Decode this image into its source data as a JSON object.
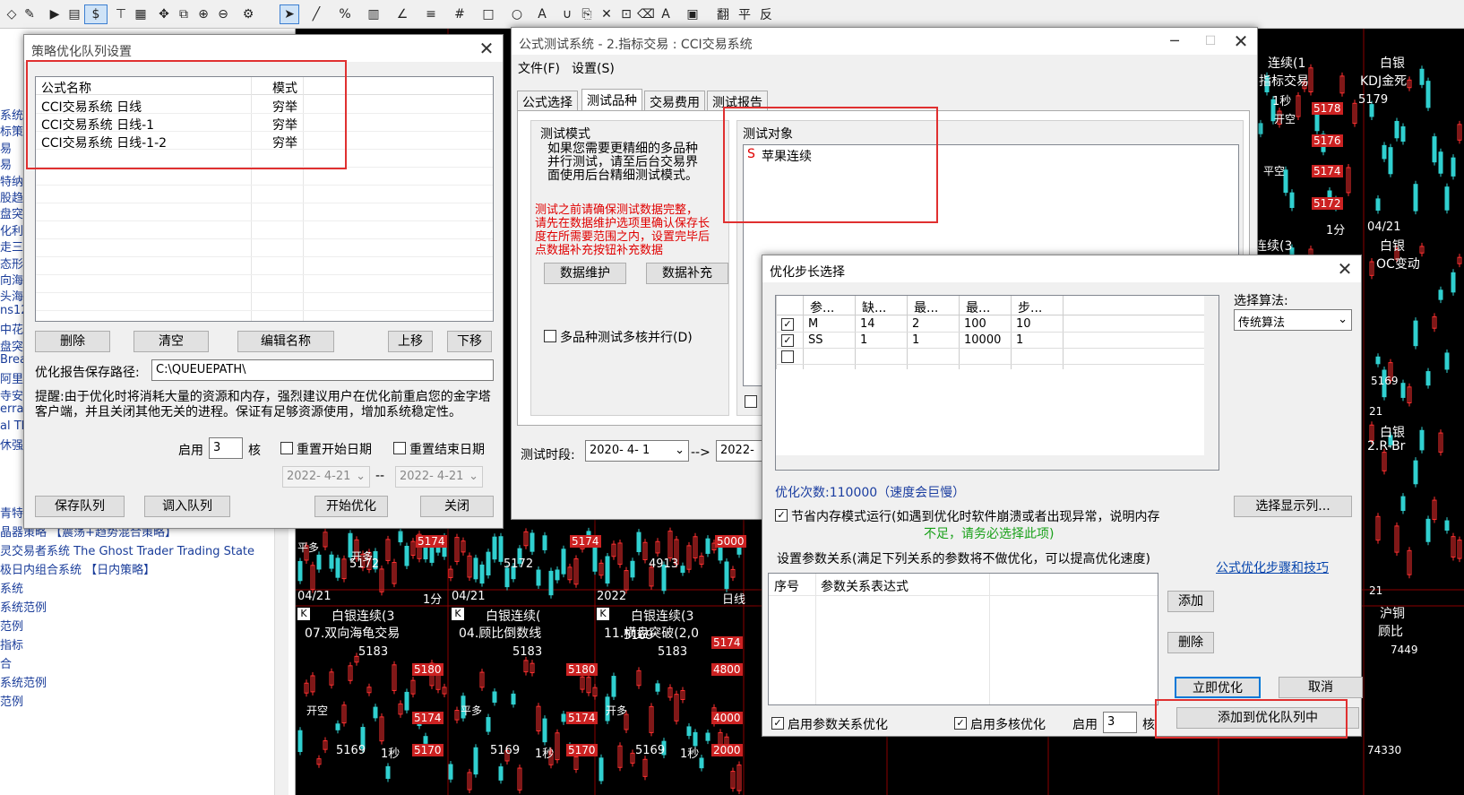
{
  "toolbar": {
    "currency_symbol": "$",
    "text_tool": "A",
    "right_tools": [
      "翻",
      "平",
      "反"
    ]
  },
  "left_panel": {
    "items": [
      "系统",
      "标策",
      "易",
      "易",
      "特纳",
      "股趋",
      "盘突",
      "化利",
      "走三",
      "态形",
      "向海",
      "头海",
      "ns12",
      "中花",
      "盘突",
      "Brea",
      "阿里",
      "寺安",
      "erra",
      "al Tl",
      "休强",
      "青特纳交易系统 【中长期策略】",
      "晶器策略 【震荡+趋势混合策略】",
      "灵交易者系统 The Ghost Trader Trading State",
      "极日内组合系统 【日内策略】",
      "系统",
      "系统范例",
      "范例",
      "指标",
      "合",
      "系统范例",
      "范例"
    ]
  },
  "charts": {
    "top_right": [
      {
        "title": "连续(1",
        "sub": "指标交易",
        "p1": "5178",
        "p2": "5176",
        "p3": "5174",
        "p4": "5172",
        "t1": "1秒",
        "t2": "开空",
        "t3": "平空",
        "t4": "1分",
        "t5": "04/21"
      },
      {
        "title": "白银",
        "sub": "KDJ金死",
        "p1": "5179"
      }
    ],
    "row1": [
      {
        "date": "04/21",
        "time": "1分",
        "title": "白银连续(3",
        "sub": "07.双向海龟交易",
        "price": "5183",
        "p_a": "5180",
        "p_b": "5174",
        "p_c": "5170",
        "bottom": "5169",
        "tb": "1秒",
        "m": "开空",
        "p_top": "5174",
        "p_mid": "5172",
        "m2": "平多",
        "m3": "开多"
      },
      {
        "date": "04/21",
        "time": "",
        "title": "白银连续(",
        "sub": "04.顾比倒数线",
        "price": "5183",
        "p_a": "5180",
        "p_b": "5174",
        "p_c": "5170",
        "bottom": "5169",
        "tb": "1秒",
        "m": "平多",
        "p_top": "5174",
        "p_mid": "5172"
      },
      {
        "date": "2022",
        "time": "日线",
        "title": "白银连续(3",
        "sub": "11.横盘突破(2,0",
        "price": "5183",
        "p_a": "4800",
        "p_b": "4000",
        "p_c": "2000",
        "bottom": "5169",
        "tb": "1秒",
        "m": "开多",
        "p_top": "5000",
        "p_mid": "4913",
        "p_x": "5174",
        "p_y": "5169"
      }
    ],
    "right_col": {
      "a": "连续(3",
      "b": "白银",
      "c": "OC变动",
      "d": "5169",
      "e": "21",
      "f": "白银",
      "g": "2.R-Br",
      "h": "21",
      "i": "沪铜",
      "j": "顾比",
      "k": "7449",
      "l": "74330",
      "m": "5174",
      "n": "04/21",
      "o": "1分",
      "p": "21",
      "q": "K"
    }
  },
  "win1": {
    "title": "策略优化队列设置",
    "col_name": "公式名称",
    "col_mode": "模式",
    "rows": [
      {
        "name": "CCI交易系统 日线",
        "mode": "穷举"
      },
      {
        "name": "CCI交易系统 日线-1",
        "mode": "穷举"
      },
      {
        "name": "CCI交易系统 日线-1-2",
        "mode": "穷举"
      }
    ],
    "btn_delete": "删除",
    "btn_clear": "清空",
    "btn_rename": "编辑名称",
    "btn_up": "上移",
    "btn_down": "下移",
    "path_label": "优化报告保存路径:",
    "path_value": "C:\\QUEUEPATH\\",
    "tip": "提醒:由于优化时将消耗大量的资源和内存，强烈建议用户在优化前重启您的金字塔客户端，并且关闭其他无关的进程。保证有足够资源使用，增加系统稳定性。",
    "cores_label": "启用",
    "cores_value": "3",
    "cores_unit": "核",
    "reset_start": "重置开始日期",
    "reset_end": "重置结束日期",
    "date_start": "2022- 4-21",
    "date_sep": "--",
    "date_end": "2022- 4-21",
    "btn_save": "保存队列",
    "btn_load": "调入队列",
    "btn_start": "开始优化",
    "btn_close": "关闭"
  },
  "win2": {
    "title": "公式测试系统 - 2.指标交易 : CCI交易系统",
    "menu": [
      "文件(F)",
      "设置(S)"
    ],
    "tabs": [
      "公式选择",
      "测试品种",
      "交易费用",
      "测试报告"
    ],
    "mode_title": "测试模式",
    "mode_desc": [
      "如果您需要更精细的多品种",
      "并行测试，请至后台交易界",
      "面使用后台精细测试模式。"
    ],
    "warn": [
      "测试之前请确保测试数据完整，",
      "请先在数据维护选项里确认保存长",
      "度在所需要范围之内，设置完毕后",
      "点数据补充按钮补充数据"
    ],
    "btn_maint": "数据维护",
    "btn_supp": "数据补充",
    "multi": "多品种测试多核并行(D)",
    "target_title": "测试对象",
    "target_tag": "S",
    "target_item": "苹果连续",
    "period_label": "测试时段:",
    "period_from": "2020- 4- 1",
    "period_arrow": "-->",
    "period_to": "2022-"
  },
  "win3": {
    "title": "优化步长选择",
    "cols": [
      "参...",
      "缺...",
      "最...",
      "最...",
      "步..."
    ],
    "rows": [
      {
        "checked": "✓",
        "param": "M",
        "def": "14",
        "min": "2",
        "max": "100",
        "step": "10"
      },
      {
        "checked": "✓",
        "param": "SS",
        "def": "1",
        "min": "1",
        "max": "10000",
        "step": "1"
      },
      {
        "checked": "",
        "param": "",
        "def": "",
        "min": "",
        "max": "",
        "step": ""
      }
    ],
    "algo_label": "选择算法:",
    "algo_value": "传统算法",
    "count": "优化次数:110000（速度会巨慢）",
    "btn_cols": "选择显示列...",
    "save_mem": "节省内存模式运行(如遇到优化时软件崩溃或者出现异常，说明内存",
    "save_mem2": "不足，请务必选择此项)",
    "rel_label": "设置参数关系(满足下列关系的参数将不做优化，可以提高优化速度)",
    "link": "公式优化步骤和技巧",
    "rel_col1": "序号",
    "rel_col2": "参数关系表达式",
    "btn_add": "添加",
    "btn_del": "删除",
    "btn_opt": "立即优化",
    "btn_cancel": "取消",
    "btn_queue": "添加到优化队列中",
    "en_rel": "启用参数关系优化",
    "en_multi": "启用多核优化",
    "cores_label": "启用",
    "cores_value": "3",
    "cores_unit": "核"
  },
  "colors": {
    "accent": "#0078d7",
    "highlight": "#e03030",
    "candle_up": "#ff3030",
    "candle_dn": "#30d0d0"
  }
}
